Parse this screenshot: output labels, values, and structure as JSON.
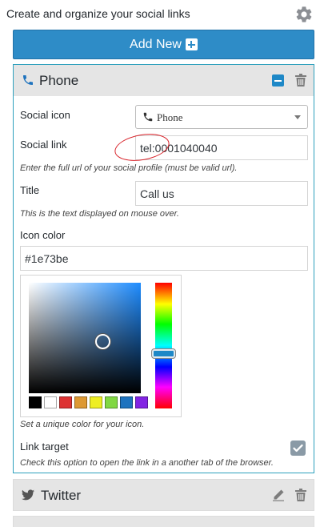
{
  "header": {
    "title": "Create and organize your social links"
  },
  "toolbar": {
    "add_new_label": "Add New"
  },
  "panel": {
    "title": "Phone",
    "fields": {
      "social_icon_label": "Social icon",
      "social_icon_value": "Phone",
      "social_link_label": "Social link",
      "social_link_value": "tel:0001040040",
      "social_link_help": "Enter the full url of your social profile (must be valid url).",
      "title_label": "Title",
      "title_value": "Call us",
      "title_help": "This is the text displayed on mouse over.",
      "icon_color_label": "Icon color",
      "icon_color_value": "#1e73be",
      "icon_color_help": "Set a unique color for your icon.",
      "link_target_label": "Link target",
      "link_target_checked": true,
      "link_target_help": "Check this option to open the link in a another tab of the browser."
    }
  },
  "color_picker": {
    "swatches": [
      "#000000",
      "#ffffff",
      "#dd3333",
      "#dd9933",
      "#eeee22",
      "#81d742",
      "#1e73be",
      "#8224e3"
    ]
  },
  "collapsed_panels": [
    {
      "title": "Twitter",
      "icon": "twitter-icon"
    }
  ],
  "colors": {
    "accent": "#2e8cc7",
    "panel_border": "#2da0bd",
    "annotation": "#d8232a"
  }
}
